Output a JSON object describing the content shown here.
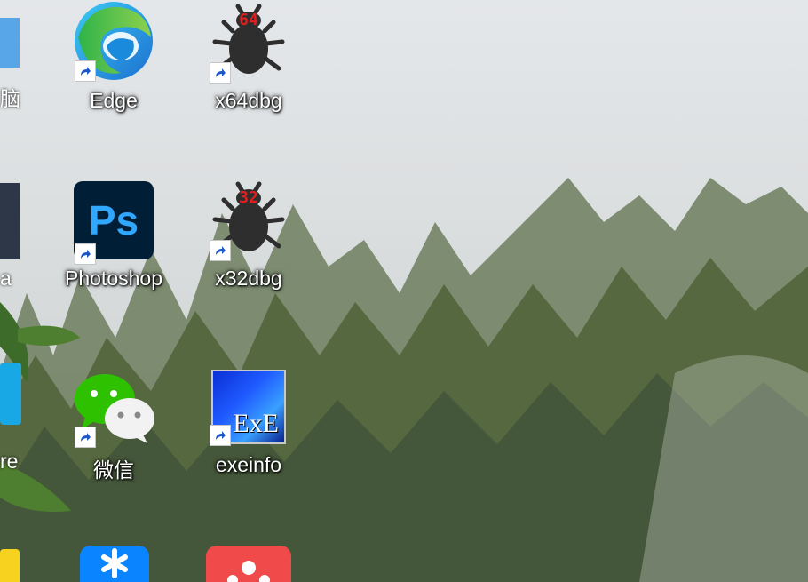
{
  "desktop": {
    "icons": [
      {
        "label": "Edge",
        "name": "edge"
      },
      {
        "label": "x64dbg",
        "name": "x64dbg",
        "badge": "64"
      },
      {
        "label": "Photoshop",
        "name": "photoshop",
        "logo": "Ps"
      },
      {
        "label": "x32dbg",
        "name": "x32dbg",
        "badge": "32"
      },
      {
        "label": "微信",
        "name": "wechat"
      },
      {
        "label": "exeinfo",
        "name": "exeinfo",
        "logo": "ExE"
      }
    ],
    "partial_left": [
      {
        "label": "脑"
      },
      {
        "label": "a"
      },
      {
        "label": "re"
      }
    ]
  }
}
